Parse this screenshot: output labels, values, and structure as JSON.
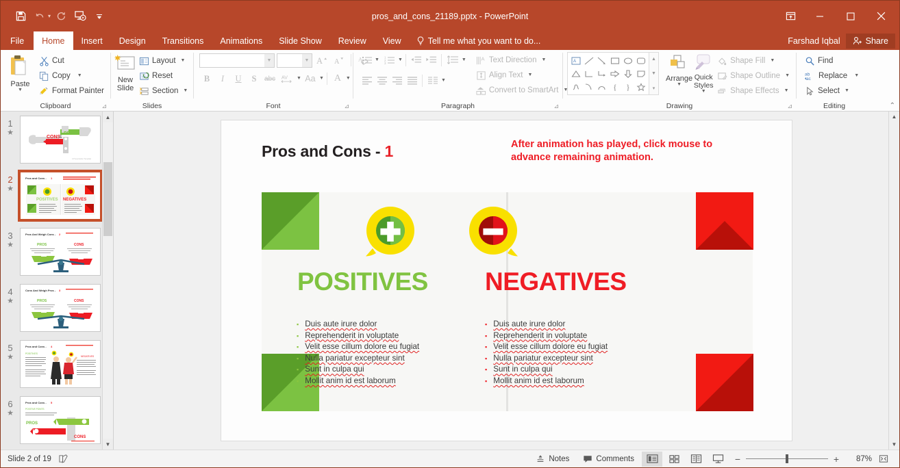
{
  "window": {
    "title": "pros_and_cons_21189.pptx - PowerPoint",
    "qat": [
      {
        "name": "save-icon",
        "label": "Save"
      },
      {
        "name": "undo-icon",
        "label": "Undo"
      },
      {
        "name": "redo-icon",
        "label": "Repeat"
      },
      {
        "name": "start-from-beginning-icon",
        "label": "Start From Beginning"
      },
      {
        "name": "customize-quick-access-toolbar-icon",
        "label": "Customize Quick Access Toolbar"
      }
    ],
    "controls": {
      "ribbon_display_options": "Ribbon Display Options",
      "minimize": "Minimize",
      "restore": "Restore Down",
      "close": "Close"
    }
  },
  "tabs": [
    {
      "label": "File",
      "active": false
    },
    {
      "label": "Home",
      "active": true
    },
    {
      "label": "Insert",
      "active": false
    },
    {
      "label": "Design",
      "active": false
    },
    {
      "label": "Transitions",
      "active": false
    },
    {
      "label": "Animations",
      "active": false
    },
    {
      "label": "Slide Show",
      "active": false
    },
    {
      "label": "Review",
      "active": false
    },
    {
      "label": "View",
      "active": false
    }
  ],
  "tellme": {
    "placeholder": "Tell me what you want to do..."
  },
  "account": {
    "user_name": "Farshad Iqbal",
    "share_label": "Share"
  },
  "ribbon": {
    "groups": [
      {
        "name": "Clipboard",
        "label": "Clipboard",
        "paste_label": "Paste",
        "items": [
          {
            "label": "Cut",
            "icon": "scissors-icon"
          },
          {
            "label": "Copy",
            "icon": "copy-icon"
          },
          {
            "label": "Format Painter",
            "icon": "format-painter-icon"
          }
        ]
      },
      {
        "name": "Slides",
        "label": "Slides",
        "new_slide_label": "New Slide",
        "items": [
          {
            "label": "Layout",
            "icon": "layout-icon"
          },
          {
            "label": "Reset",
            "icon": "reset-icon"
          },
          {
            "label": "Section",
            "icon": "section-icon"
          }
        ]
      },
      {
        "name": "Font",
        "label": "Font",
        "font_name_value": "",
        "font_size_value": "",
        "buttons": [
          "B",
          "I",
          "U",
          "S",
          "abc",
          "AV",
          "Aa",
          "A"
        ]
      },
      {
        "name": "Paragraph",
        "label": "Paragraph",
        "items": [
          {
            "label": "Text Direction",
            "icon": "text-direction-icon"
          },
          {
            "label": "Align Text",
            "icon": "align-text-icon"
          },
          {
            "label": "Convert to SmartArt",
            "icon": "smartart-icon"
          }
        ]
      },
      {
        "name": "Drawing",
        "label": "Drawing",
        "arrange_label": "Arrange",
        "quick_styles_label": "Quick Styles",
        "items": [
          {
            "label": "Shape Fill",
            "icon": "shape-fill-icon"
          },
          {
            "label": "Shape Outline",
            "icon": "shape-outline-icon"
          },
          {
            "label": "Shape Effects",
            "icon": "shape-effects-icon"
          }
        ]
      },
      {
        "name": "Editing",
        "label": "Editing",
        "items": [
          {
            "label": "Find",
            "icon": "search-icon"
          },
          {
            "label": "Replace",
            "icon": "replace-icon"
          },
          {
            "label": "Select",
            "icon": "select-pointer-icon"
          }
        ]
      }
    ]
  },
  "thumbnails": [
    {
      "number": "1",
      "selected": false,
      "title": "CONS & PROS"
    },
    {
      "number": "2",
      "selected": true,
      "title": "Pros and Cons - 1"
    },
    {
      "number": "3",
      "selected": false,
      "title": "Pros And Weigh Cons - 2"
    },
    {
      "number": "4",
      "selected": false,
      "title": "Cons And Weigh Pros - 3"
    },
    {
      "number": "5",
      "selected": false,
      "title": "Pros and Cons - 4"
    },
    {
      "number": "6",
      "selected": false,
      "title": "Pros and Cons - 5"
    }
  ],
  "slide": {
    "title_text": "Pros and Cons - ",
    "title_number": "1",
    "note": "After animation has played, click mouse to advance remaining animation.",
    "positives": {
      "heading": "POSITIVES",
      "badge_icon": "plus-speech-bubble-icon",
      "bullets": [
        "Duis aute irure dolor",
        "Reprehenderit in voluptate",
        "Velit esse cillum dolore eu fugiat",
        "Nulla pariatur excepteur sint",
        "Sunt in culpa qui",
        "Mollit anim id est laborum"
      ]
    },
    "negatives": {
      "heading": "NEGATIVES",
      "badge_icon": "minus-speech-bubble-icon",
      "bullets": [
        "Duis aute irure dolor",
        "Reprehenderit in voluptate",
        "Velit esse cillum dolore eu fugiat",
        "Nulla pariatur excepteur sint",
        "Sunt in culpa qui",
        "Mollit anim id est laborum"
      ]
    }
  },
  "status": {
    "slide_indicator": "Slide 2 of 19",
    "notes_label": "Notes",
    "comments_label": "Comments",
    "zoom_percent": "87%",
    "views": [
      "normal-view",
      "slide-sorter-view",
      "reading-view",
      "slide-show-view"
    ]
  },
  "colors": {
    "accent": "#b7472a",
    "positive_green": "#80c341",
    "negative_red": "#ef1d25",
    "badge_yellow": "#f9e000",
    "note_red": "#ee1c25",
    "corner_green_dark": "#5a9e29",
    "corner_green_light": "#7cc242",
    "corner_red_dark": "#b81009",
    "corner_red_light": "#f21a13"
  }
}
